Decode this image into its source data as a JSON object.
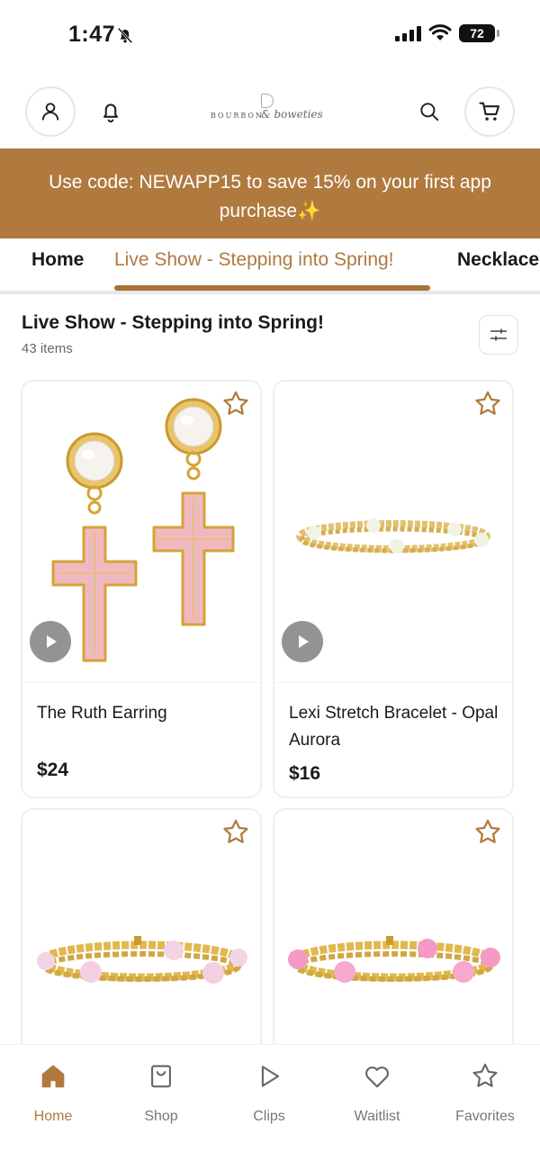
{
  "status_bar": {
    "time": "1:47",
    "battery": "72"
  },
  "header": {
    "logo_wordmark": "BOURBON",
    "logo_script": "& boweties"
  },
  "promo_banner": {
    "text": "Use code: NEWAPP15 to save 15% on your first app purchase✨"
  },
  "tabs": [
    {
      "label": "Home"
    },
    {
      "label": "Live Show - Stepping into Spring!",
      "active": true
    },
    {
      "label": "Necklace"
    }
  ],
  "section": {
    "title": "Live Show - Stepping into Spring!",
    "count": "43 items"
  },
  "products": [
    {
      "name": "The Ruth Earring",
      "price": "$24",
      "has_video": true
    },
    {
      "name": "Lexi Stretch Bracelet - Opal Aurora",
      "price": "$16",
      "has_video": true
    },
    {
      "name": "",
      "price": "",
      "has_video": false
    },
    {
      "name": "",
      "price": "",
      "has_video": false
    }
  ],
  "bottom_nav": [
    {
      "label": "Home",
      "icon": "home-icon",
      "active": true
    },
    {
      "label": "Shop",
      "icon": "shop-icon"
    },
    {
      "label": "Clips",
      "icon": "play-icon"
    },
    {
      "label": "Waitlist",
      "icon": "heart-icon"
    },
    {
      "label": "Favorites",
      "icon": "star-icon"
    }
  ],
  "colors": {
    "accent": "#b07a3e",
    "banner_bg": "#b07a3e",
    "icon_star": "#b07a3e"
  }
}
